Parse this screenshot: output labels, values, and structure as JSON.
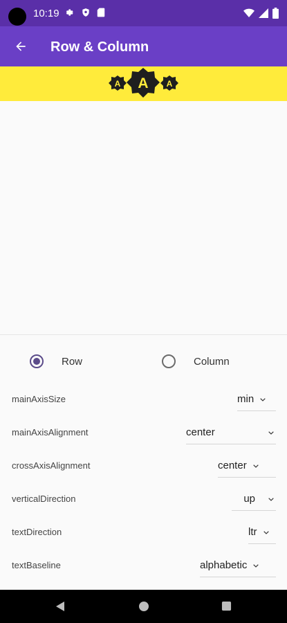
{
  "status_bar": {
    "time": "10:19",
    "icons_left": [
      "gear-icon",
      "shield-icon",
      "sd-card-icon"
    ],
    "icons_right": [
      "wifi-icon",
      "signal-icon",
      "battery-icon"
    ]
  },
  "app_bar": {
    "title": "Row & Column",
    "back_icon": "arrow-back-icon"
  },
  "banner": {
    "color": "#ffeb3b",
    "glyph": "A"
  },
  "layout_mode": {
    "options": [
      {
        "label": "Row",
        "selected": true
      },
      {
        "label": "Column",
        "selected": false
      }
    ]
  },
  "properties": [
    {
      "label": "mainAxisSize",
      "value": "min"
    },
    {
      "label": "mainAxisAlignment",
      "value": "center"
    },
    {
      "label": "crossAxisAlignment",
      "value": "center"
    },
    {
      "label": "verticalDirection",
      "value": "up"
    },
    {
      "label": "textDirection",
      "value": "ltr"
    },
    {
      "label": "textBaseline",
      "value": "alphabetic"
    }
  ],
  "colors": {
    "status_bar": "#5a2fa8",
    "app_bar": "#6a3fc6",
    "banner": "#ffeb3b",
    "radio_selected": "#5b4b8a"
  }
}
